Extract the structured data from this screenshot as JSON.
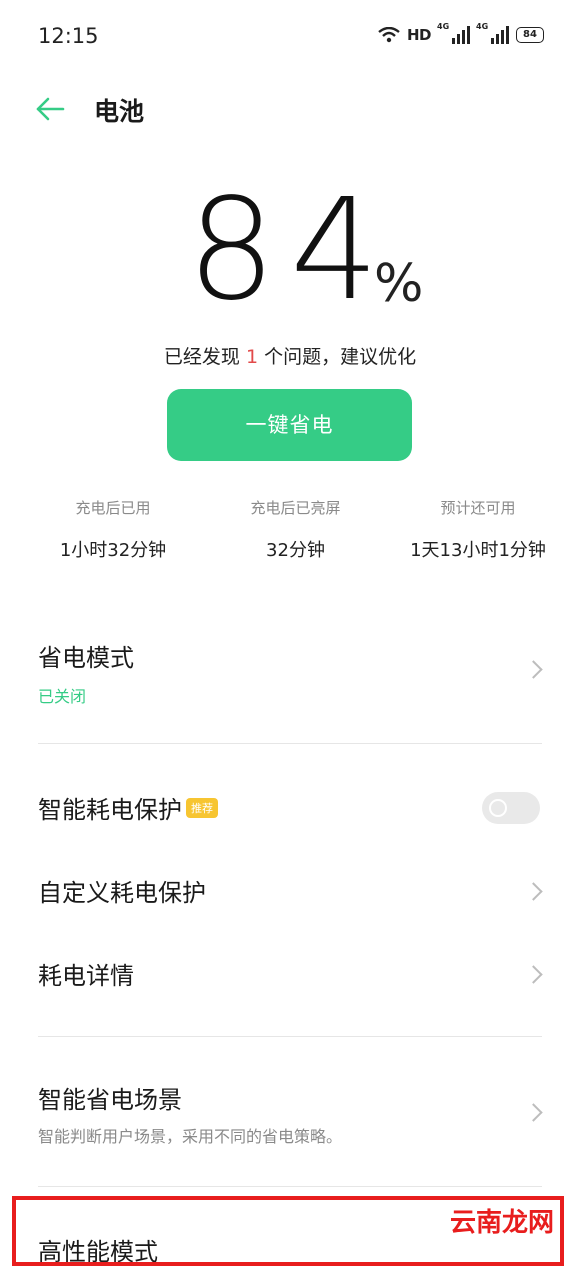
{
  "status_bar": {
    "time": "12:15",
    "hd_label": "HD",
    "network_1": "4G",
    "network_2": "4G",
    "battery": "84"
  },
  "header": {
    "title": "电池"
  },
  "battery": {
    "percent": "84",
    "percent_sign": "%"
  },
  "issue": {
    "prefix": "已经发现 ",
    "count": "1",
    "suffix": " 个问题，建议优化"
  },
  "one_key_button": "一键省电",
  "stats": [
    {
      "label": "充电后已用",
      "value": "1小时32分钟"
    },
    {
      "label": "充电后已亮屏",
      "value": "32分钟"
    },
    {
      "label": "预计还可用",
      "value": "1天13小时1分钟"
    }
  ],
  "settings": {
    "power_saving_mode": {
      "title": "省电模式",
      "status": "已关闭"
    },
    "smart_protection": {
      "title": "智能耗电保护",
      "tag": "推荐",
      "toggle_on": false
    },
    "custom_protection": {
      "title": "自定义耗电保护"
    },
    "consumption_details": {
      "title": "耗电详情"
    },
    "smart_scenes": {
      "title": "智能省电场景",
      "subtitle": "智能判断用户场景，采用不同的省电策略。"
    },
    "high_performance": {
      "title": "高性能模式"
    }
  },
  "watermark": "云南龙网",
  "colors": {
    "accent": "#35cc86",
    "issue_number": "#e24a4a",
    "status_green": "#35cc86",
    "tag": "#f7c531",
    "highlight": "#e81d1d"
  }
}
